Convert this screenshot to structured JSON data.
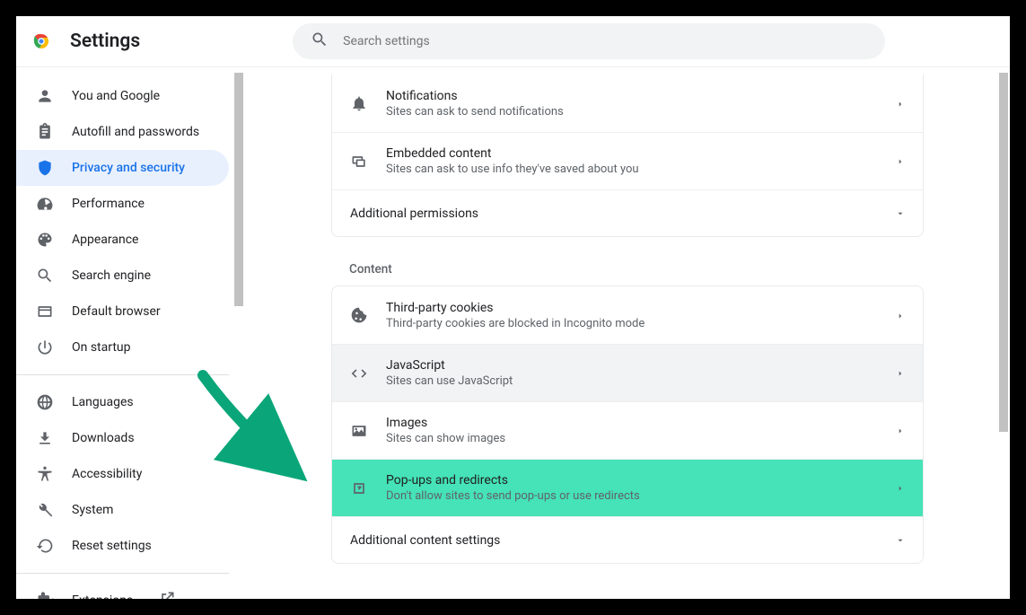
{
  "header": {
    "title": "Settings",
    "search_placeholder": "Search settings"
  },
  "sidebar": {
    "groups": [
      [
        {
          "id": "you-and-google",
          "label": "You and Google",
          "icon": "person"
        },
        {
          "id": "autofill",
          "label": "Autofill and passwords",
          "icon": "clipboard"
        },
        {
          "id": "privacy",
          "label": "Privacy and security",
          "icon": "shield",
          "active": true
        },
        {
          "id": "performance",
          "label": "Performance",
          "icon": "speed"
        },
        {
          "id": "appearance",
          "label": "Appearance",
          "icon": "palette"
        },
        {
          "id": "search-engine",
          "label": "Search engine",
          "icon": "search"
        },
        {
          "id": "default-browser",
          "label": "Default browser",
          "icon": "browser"
        },
        {
          "id": "on-startup",
          "label": "On startup",
          "icon": "power"
        }
      ],
      [
        {
          "id": "languages",
          "label": "Languages",
          "icon": "globe"
        },
        {
          "id": "downloads",
          "label": "Downloads",
          "icon": "download"
        },
        {
          "id": "accessibility",
          "label": "Accessibility",
          "icon": "accessibility"
        },
        {
          "id": "system",
          "label": "System",
          "icon": "wrench"
        },
        {
          "id": "reset",
          "label": "Reset settings",
          "icon": "restore"
        }
      ],
      [
        {
          "id": "extensions",
          "label": "Extensions",
          "icon": "extension",
          "ext": true
        }
      ]
    ]
  },
  "main": {
    "perm_rows": [
      {
        "id": "notifications",
        "title": "Notifications",
        "sub": "Sites can ask to send notifications",
        "icon": "bell"
      },
      {
        "id": "embedded",
        "title": "Embedded content",
        "sub": "Sites can ask to use info they've saved about you",
        "icon": "embed"
      }
    ],
    "additional_permissions_label": "Additional permissions",
    "content_label": "Content",
    "content_rows": [
      {
        "id": "cookies",
        "title": "Third-party cookies",
        "sub": "Third-party cookies are blocked in Incognito mode",
        "icon": "cookie"
      },
      {
        "id": "javascript",
        "title": "JavaScript",
        "sub": "Sites can use JavaScript",
        "icon": "code",
        "hover": true
      },
      {
        "id": "images",
        "title": "Images",
        "sub": "Sites can show images",
        "icon": "image"
      },
      {
        "id": "popups",
        "title": "Pop-ups and redirects",
        "sub": "Don't allow sites to send pop-ups or use redirects",
        "icon": "popup",
        "highlight": true
      }
    ],
    "additional_content_label": "Additional content settings"
  }
}
